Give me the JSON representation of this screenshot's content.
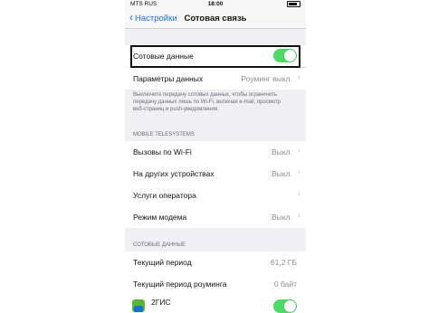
{
  "status_bar": {
    "carrier": "MTS RUS",
    "time": "18:00",
    "battery": ""
  },
  "nav": {
    "back_label": "Настройки",
    "title": "Сотовая связь"
  },
  "cellular_data": {
    "label": "Сотовые данные",
    "enabled": true
  },
  "data_options": {
    "label": "Параметры данных",
    "value": "Роуминг выкл."
  },
  "footnote": "Выключите передачу сотовых данных, чтобы ограничить передачу данных лишь по Wi-Fi, включая e-mail, просмотр веб-страниц и push-уведомления.",
  "operator_section": {
    "header": "MOBILE TELESYSTEMS",
    "items": [
      {
        "label": "Вызовы по Wi-Fi",
        "value": "Выкл."
      },
      {
        "label": "На других устройствах",
        "value": "Выкл."
      },
      {
        "label": "Услуги оператора",
        "value": ""
      },
      {
        "label": "Режим модема",
        "value": "Выкл."
      }
    ]
  },
  "usage_section": {
    "header": "СОТОВЫЕ ДАННЫЕ",
    "items": [
      {
        "label": "Текущий период",
        "value": "61,2 ГБ"
      },
      {
        "label": "Текущий период роуминга",
        "value": "0 байт"
      }
    ]
  },
  "apps": [
    {
      "name": "2ГИС",
      "enabled": true
    }
  ],
  "colors": {
    "accent": "#1e6ee6",
    "toggle_on": "#4cd964",
    "background": "#efeff4"
  }
}
